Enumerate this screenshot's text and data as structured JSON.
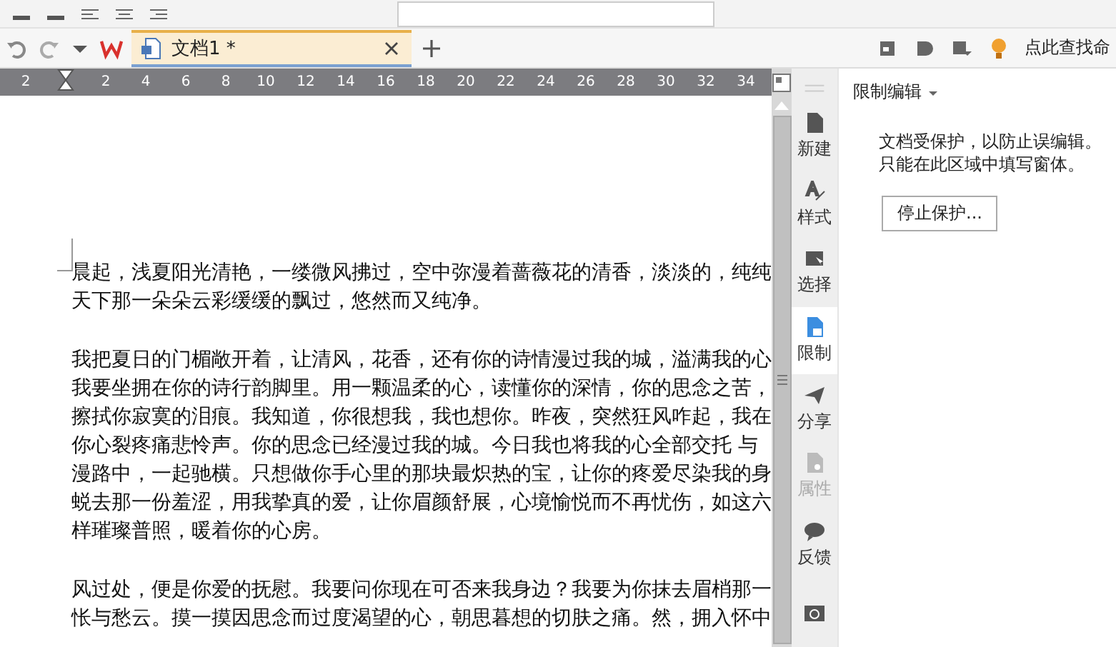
{
  "tab_bar": {
    "document_tab": {
      "title": "文档1 *",
      "selected": true
    },
    "search_hint": "点此查找命"
  },
  "ruler": {
    "labels": [
      "2",
      "2",
      "4",
      "6",
      "8",
      "10",
      "12",
      "14",
      "16",
      "18",
      "20",
      "22",
      "24",
      "26",
      "28",
      "30",
      "32",
      "34"
    ]
  },
  "document": {
    "paragraphs": [
      [
        "晨起，浅夏阳光清艳，一缕微风拂过，空中弥漫着蔷薇花的清香，淡淡的，纯纯",
        "天下那一朵朵云彩缓缓的飘过，悠然而又纯净。"
      ],
      [
        "我把夏日的门楣敞开着，让清风，花香，还有你的诗情漫过我的城，溢满我的心",
        "我要坐拥在你的诗行韵脚里。用一颗温柔的心，读懂你的深情，你的思念之苦，",
        "擦拭你寂寞的泪痕。我知道，你很想我，我也想你。昨夜，突然狂风咋起，我在",
        "你心裂疼痛悲怜声。你的思念已经漫过我的城。今日我也将我的心全部交托 与",
        "漫路中，一起驰横。只想做你手心里的那块最炽热的宝，让你的疼爱尽染我的身",
        "蜕去那一份羞涩，用我挚真的爱，让你眉颜舒展，心境愉悦而不再忧伤，如这六",
        "样璀璨普照，暖着你的心房。"
      ],
      [
        "风过处，便是你爱的抚慰。我要问你现在可否来我身边？我要为你抹去眉梢那一",
        "怅与愁云。摸一摸因思念而过度渴望的心，朝思暮想的切肤之痛。然，拥入怀中"
      ]
    ]
  },
  "side_tabs": [
    {
      "kind": "new",
      "label": "新建",
      "selected": false,
      "disabled": false
    },
    {
      "kind": "style",
      "label": "样式",
      "selected": false,
      "disabled": false
    },
    {
      "kind": "select",
      "label": "选择",
      "selected": false,
      "disabled": false
    },
    {
      "kind": "restrict",
      "label": "限制",
      "selected": true,
      "disabled": false
    },
    {
      "kind": "share",
      "label": "分享",
      "selected": false,
      "disabled": false
    },
    {
      "kind": "properties",
      "label": "属性",
      "selected": false,
      "disabled": true
    },
    {
      "kind": "feedback",
      "label": "反馈",
      "selected": false,
      "disabled": false
    },
    {
      "kind": "backup",
      "selected": false,
      "disabled": false
    }
  ],
  "panel": {
    "title": "限制编辑",
    "message_lines": [
      "文档受保护，以防止误编辑。",
      "只能在此区域中填写窗体。"
    ],
    "button": "停止保护..."
  }
}
